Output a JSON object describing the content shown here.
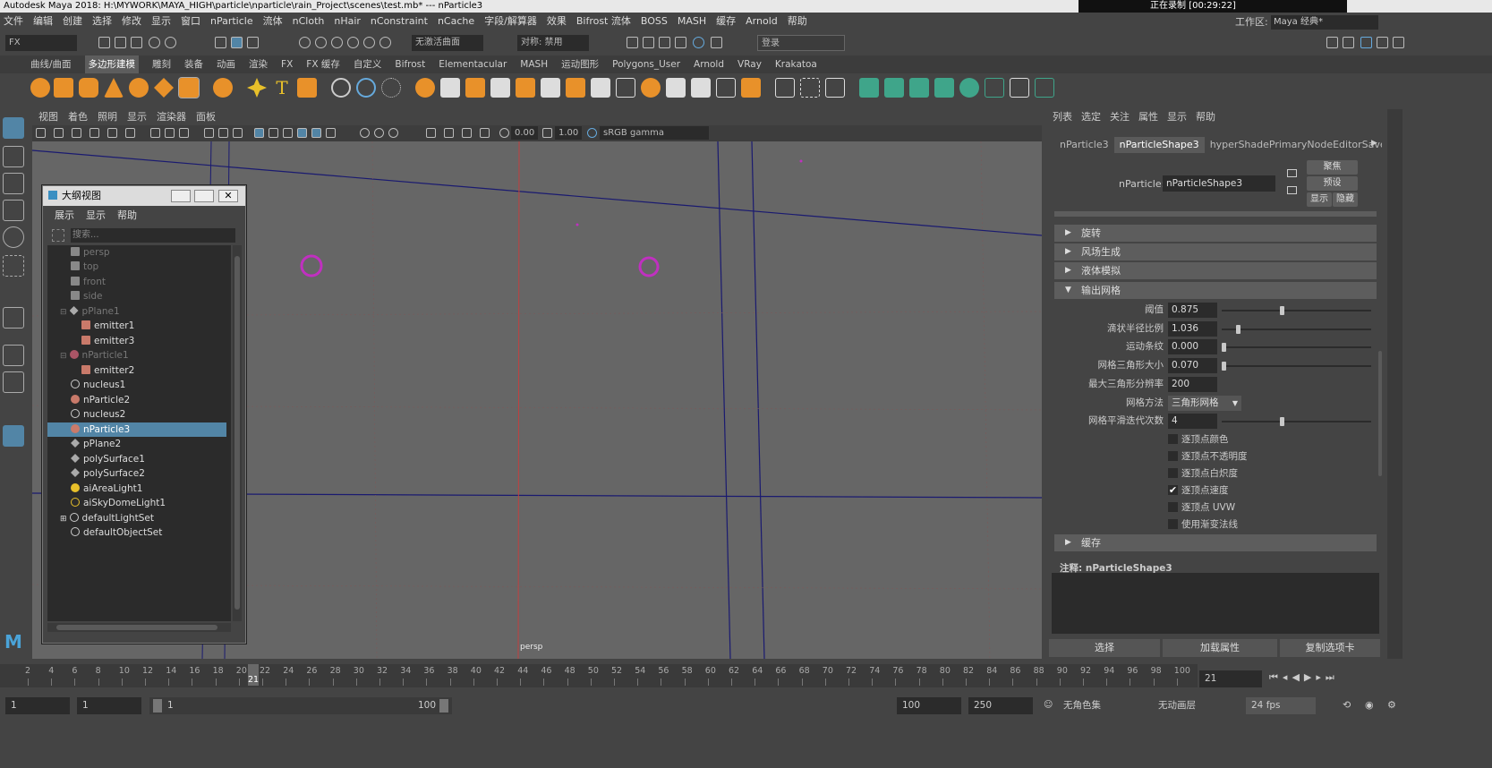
{
  "window": {
    "title": "Autodesk Maya 2018: H:\\MYWORK\\MAYA_HIGH\\particle\\nparticle\\rain_Project\\scenes\\test.mb*   ---   nParticle3",
    "recording": "正在录制 [00:29:22]"
  },
  "menubar": [
    "文件",
    "编辑",
    "创建",
    "选择",
    "修改",
    "显示",
    "窗口",
    "nParticle",
    "流体",
    "nCloth",
    "nHair",
    "nConstraint",
    "nCache",
    "字段/解算器",
    "效果",
    "Bifrost 流体",
    "BOSS",
    "MASH",
    "缓存",
    "Arnold",
    "帮助"
  ],
  "workspace": {
    "label": "工作区:",
    "value": "Maya 经典*"
  },
  "statusline": {
    "menuset": "FX",
    "live_surface": "无激活曲面",
    "symmetry": "对称: 禁用",
    "login": "登录"
  },
  "shelf_tabs": [
    "曲线/曲面",
    "多边形建模",
    "雕刻",
    "装备",
    "动画",
    "渲染",
    "FX",
    "FX 缓存",
    "自定义",
    "Bifrost",
    "Elementacular",
    "MASH",
    "运动图形",
    "Polygons_User",
    "Arnold",
    "VRay",
    "Krakatoa"
  ],
  "shelf_active": "多边形建模",
  "viewport": {
    "menu": [
      "视图",
      "着色",
      "照明",
      "显示",
      "渲染器",
      "面板"
    ],
    "exposure": "0.00",
    "gamma": "1.00",
    "colorspace": "sRGB gamma",
    "camera_label": "persp"
  },
  "outliner": {
    "title": "大纲视图",
    "menu": [
      "展示",
      "显示",
      "帮助"
    ],
    "search_placeholder": "搜索...",
    "items": [
      {
        "label": "persp",
        "kind": "camera",
        "dim": true
      },
      {
        "label": "top",
        "kind": "camera",
        "dim": true
      },
      {
        "label": "front",
        "kind": "camera",
        "dim": true
      },
      {
        "label": "side",
        "kind": "camera",
        "dim": true
      },
      {
        "label": "pPlane1",
        "kind": "mesh",
        "dim": true,
        "expanded": true
      },
      {
        "label": "emitter1",
        "kind": "emitter",
        "indent": 1
      },
      {
        "label": "emitter3",
        "kind": "emitter",
        "indent": 1
      },
      {
        "label": "nParticle1",
        "kind": "particle",
        "dim": true,
        "expanded": true
      },
      {
        "label": "emitter2",
        "kind": "emitter",
        "indent": 1
      },
      {
        "label": "nucleus1",
        "kind": "nucleus"
      },
      {
        "label": "nParticle2",
        "kind": "particle"
      },
      {
        "label": "nucleus2",
        "kind": "nucleus"
      },
      {
        "label": "nParticle3",
        "kind": "particle",
        "selected": true
      },
      {
        "label": "pPlane2",
        "kind": "mesh"
      },
      {
        "label": "polySurface1",
        "kind": "mesh"
      },
      {
        "label": "polySurface2",
        "kind": "mesh"
      },
      {
        "label": "aiAreaLight1",
        "kind": "light"
      },
      {
        "label": "aiSkyDomeLight1",
        "kind": "light"
      },
      {
        "label": "defaultLightSet",
        "kind": "set",
        "collapsed": true
      },
      {
        "label": "defaultObjectSet",
        "kind": "set"
      }
    ]
  },
  "attribute_editor": {
    "menu": [
      "列表",
      "选定",
      "关注",
      "属性",
      "显示",
      "帮助"
    ],
    "tabs": [
      "nParticle3",
      "nParticleShape3",
      "hyperShadePrimaryNodeEditorSaved"
    ],
    "active_tab": "nParticleShape3",
    "node_label": "nParticle:",
    "node_value": "nParticleShape3",
    "buttons": {
      "focus": "聚焦",
      "presets": "预设",
      "show": "显示",
      "hide": "隐藏"
    },
    "frames": {
      "rotation": "旋转",
      "field_gen": "风场生成",
      "liquid": "液体模拟",
      "output_mesh": "输出网格",
      "cache": "缓存"
    },
    "output_mesh": {
      "threshold": {
        "label": "阈值",
        "value": "0.875",
        "slider": 0.4
      },
      "blobby_radius": {
        "label": "滴状半径比例",
        "value": "1.036",
        "slider": 0.1
      },
      "motion_streak": {
        "label": "运动条纹",
        "value": "0.000",
        "slider": 0.0
      },
      "triangle_size": {
        "label": "网格三角形大小",
        "value": "0.070",
        "slider": 0.0
      },
      "max_resolution": {
        "label": "最大三角形分辨率",
        "value": "200"
      },
      "mesh_method": {
        "label": "网格方法",
        "value": "三角形网格"
      },
      "smoothing": {
        "label": "网格平滑迭代次数",
        "value": "4",
        "slider": 0.4
      },
      "checkboxes": [
        {
          "label": "逐顶点颜色",
          "checked": false
        },
        {
          "label": "逐顶点不透明度",
          "checked": false
        },
        {
          "label": "逐顶点白炽度",
          "checked": false
        },
        {
          "label": "逐顶点速度",
          "checked": true
        },
        {
          "label": "逐顶点 UVW",
          "checked": false
        },
        {
          "label": "使用渐变法线",
          "checked": false
        }
      ]
    },
    "notes_label": "注释: nParticleShape3",
    "bottom_buttons": [
      "选择",
      "加载属性",
      "复制选项卡"
    ]
  },
  "timeline": {
    "ticks": [
      "2",
      "4",
      "6",
      "8",
      "10",
      "12",
      "14",
      "16",
      "18",
      "20",
      "22",
      "24",
      "26",
      "28",
      "30",
      "32",
      "34",
      "36",
      "38",
      "40",
      "42",
      "44",
      "46",
      "48",
      "50",
      "52",
      "54",
      "56",
      "58",
      "60",
      "62",
      "64",
      "66",
      "68",
      "70",
      "72",
      "74",
      "76",
      "78",
      "80",
      "82",
      "84",
      "86",
      "88",
      "90",
      "92",
      "94",
      "96",
      "98",
      "100"
    ],
    "current": "21",
    "current_frame_field": "21"
  },
  "range": {
    "start": "1",
    "playback_start": "1",
    "slider_start": "1",
    "slider_end": "100",
    "playback_end": "100",
    "end": "250",
    "character_set": "无角色集",
    "anim_layer": "无动画层",
    "fps": "24 fps"
  },
  "colors": {
    "accent": "#5285a6",
    "particle": "#c030c0",
    "grid_red": "#c04040",
    "grid_blue": "#1a1a70"
  }
}
